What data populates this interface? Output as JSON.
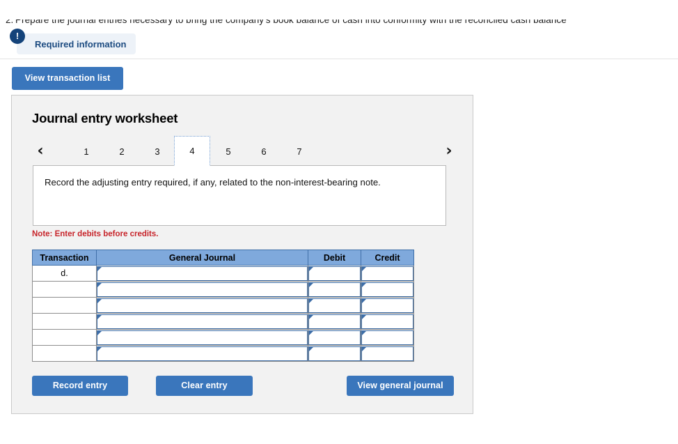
{
  "question": {
    "bullet": "2.",
    "text": "Prepare the journal entries necessary to bring the company's book balance of cash into conformity with the reconciled cash balance"
  },
  "required_badge": {
    "icon": "!",
    "label": "Required information"
  },
  "toolbar": {
    "view_transaction_list_label": "View transaction list"
  },
  "worksheet": {
    "title": "Journal entry worksheet",
    "prev_arrow_icon": "‹",
    "next_arrow_icon": "›",
    "tabs": [
      {
        "label": "1",
        "selected": false
      },
      {
        "label": "2",
        "selected": false
      },
      {
        "label": "3",
        "selected": false
      },
      {
        "label": "4",
        "selected": true
      },
      {
        "label": "5",
        "selected": false
      },
      {
        "label": "6",
        "selected": false
      },
      {
        "label": "7",
        "selected": false
      }
    ],
    "instruction": "Record the adjusting entry required, if any, related to the non-interest-bearing note.",
    "note": "Note: Enter debits before credits."
  },
  "table": {
    "headers": [
      "Transaction",
      "General Journal",
      "Debit",
      "Credit"
    ],
    "rows": [
      {
        "transaction": "d.",
        "general_journal": "",
        "debit": "",
        "credit": ""
      },
      {
        "transaction": "",
        "general_journal": "",
        "debit": "",
        "credit": ""
      },
      {
        "transaction": "",
        "general_journal": "",
        "debit": "",
        "credit": ""
      },
      {
        "transaction": "",
        "general_journal": "",
        "debit": "",
        "credit": ""
      },
      {
        "transaction": "",
        "general_journal": "",
        "debit": "",
        "credit": ""
      },
      {
        "transaction": "",
        "general_journal": "",
        "debit": "",
        "credit": ""
      }
    ]
  },
  "actions": {
    "record_entry_label": "Record entry",
    "clear_entry_label": "Clear entry",
    "view_general_journal_label": "View general journal"
  },
  "colors": {
    "button_blue": "#3a76bc",
    "table_header_blue": "#7fa9dc",
    "input_border_blue": "#3f6fa8",
    "badge_navy": "#14437a",
    "note_red": "#c7242a",
    "card_gray": "#f2f2f2"
  }
}
